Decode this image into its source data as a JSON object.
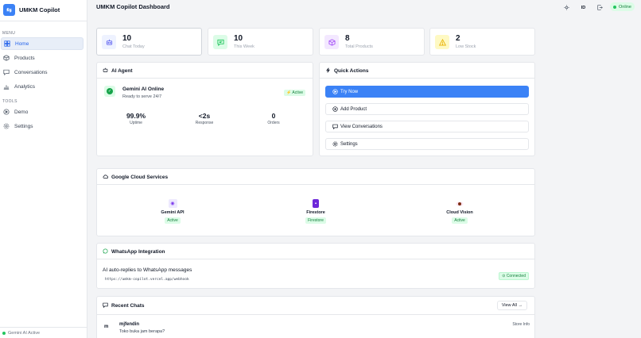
{
  "brand": {
    "logo_glyph": "⇆",
    "name": "UMKM Copilot"
  },
  "sidebar": {
    "menu_label": "MENU",
    "tools_label": "TOOLS",
    "menu_items": [
      {
        "label": "Home",
        "icon": "home-icon",
        "active": true
      },
      {
        "label": "Products",
        "icon": "box-icon"
      },
      {
        "label": "Conversations",
        "icon": "chat-icon"
      },
      {
        "label": "Analytics",
        "icon": "bar-chart-icon"
      }
    ],
    "tool_items": [
      {
        "label": "Demo",
        "icon": "play-icon"
      },
      {
        "label": "Settings",
        "icon": "gear-icon"
      }
    ],
    "footer_status": "Gemini AI Active"
  },
  "header": {
    "title": "UMKM Copilot Dashboard",
    "lang": "ID",
    "status": "Online"
  },
  "stats": [
    {
      "value": "10",
      "label": "Chat Today",
      "icon": "robot-icon",
      "bg": "#eef2ff",
      "color": "#6366f1"
    },
    {
      "value": "10",
      "label": "This Week",
      "icon": "chat-icon",
      "bg": "#dcfce7",
      "color": "#22c55e"
    },
    {
      "value": "8",
      "label": "Total Products",
      "icon": "box-icon",
      "bg": "#f3e8ff",
      "color": "#a855f7"
    },
    {
      "value": "2",
      "label": "Low Stock",
      "icon": "warning-icon",
      "bg": "#fef9c3",
      "color": "#eab308"
    }
  ],
  "ai_agent": {
    "title": "AI Agent",
    "name": "Gemini AI Online",
    "subtitle": "Ready to serve 24/7",
    "badge": "⚡ Active",
    "metrics": [
      {
        "value": "99.9%",
        "label": "Uptime"
      },
      {
        "value": "<2s",
        "label": "Response"
      },
      {
        "value": "0",
        "label": "Orders"
      }
    ]
  },
  "quick_actions": {
    "title": "Quick Actions",
    "items": [
      {
        "label": "Try Now",
        "icon": "play-icon"
      },
      {
        "label": "Add Product",
        "icon": "plus-icon"
      },
      {
        "label": "View Conversations",
        "icon": "chat-icon"
      },
      {
        "label": "Settings",
        "icon": "gear-icon"
      }
    ]
  },
  "cloud": {
    "title": "Google Cloud Services",
    "services": [
      {
        "name": "Gemini API",
        "badge": "Active"
      },
      {
        "name": "Firestore",
        "badge": "Firestore"
      },
      {
        "name": "Cloud Vision",
        "badge": "Active"
      }
    ]
  },
  "whatsapp": {
    "title": "WhatsApp Integration",
    "text": "AI auto-replies to WhatsApp messages",
    "url": "https://umkm-copilot.vercel.app/webhook",
    "status": "Connected"
  },
  "recent_chats": {
    "title": "Recent Chats",
    "view_all": "View All →",
    "items": [
      {
        "avatar": "m",
        "user": "mjfendin",
        "message": "Toko buka jam berapa?",
        "tag": "Store Info"
      }
    ]
  },
  "colors": {
    "accent": "#3b82f6",
    "success": "#16a34a",
    "border": "#e5e7eb"
  }
}
